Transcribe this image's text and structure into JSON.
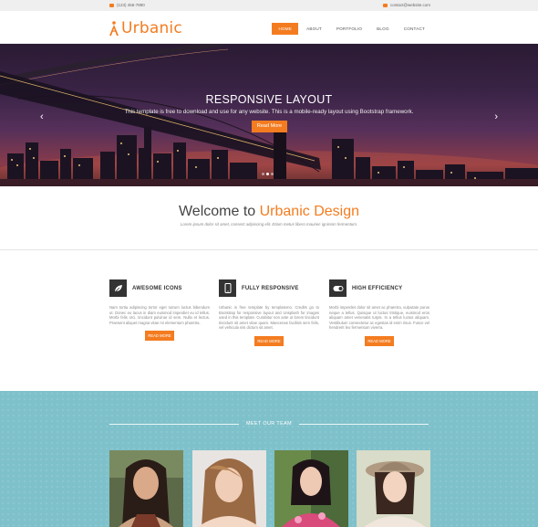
{
  "topbar": {
    "phone": "(123) 456-7890",
    "email": "contact@website.com"
  },
  "header": {
    "logo": "Urbanic",
    "nav": [
      {
        "label": "HOME",
        "active": true
      },
      {
        "label": "ABOUT",
        "active": false
      },
      {
        "label": "PORTFOLIO",
        "active": false
      },
      {
        "label": "BLOG",
        "active": false
      },
      {
        "label": "CONTACT",
        "active": false
      }
    ]
  },
  "hero": {
    "title": "RESPONSIVE LAYOUT",
    "subtitle": "This template is free to download and use for any website. This is a mobile-ready layout using Bootstrap framework.",
    "button": "Read More",
    "prev": "‹",
    "next": "›",
    "slides": 3,
    "active_slide": 2
  },
  "welcome": {
    "title_plain": "Welcome to ",
    "title_accent": "Urbanic Design",
    "subtitle": "Lorem ipsum dolor sit amet, consect adipiscing elit. Etiam metus libero mauriec ignissim fermentum."
  },
  "features": [
    {
      "icon": "leaf-icon",
      "title": "AWESOME ICONS",
      "text": "Nam tortia adipiscing tortor eget rutrum luctus bibendum ut. Donec eu lacus in diam euismod imperdiet eu id tellus. Morbi felis orci, tincidunt pulvinar id sem. Nulla et lectus. Praesent aliquet magna vitae mi elementum pharetra.",
      "button": "READ MORE"
    },
    {
      "icon": "mobile-icon",
      "title": "FULLY RESPONSIVE",
      "text": "Urbanic is free template by templatemo. Credits go to Bootstrap for responsive layout and Unsplash for images used in this template. Curabitur non ante ut lorem tincidunt tincidunt sit amet vitae quam. Maecenas facilisis sem felis, vel vehicula nisi dictum sit amet.",
      "button": "READ MORE"
    },
    {
      "icon": "toggle-icon",
      "title": "HIGH EFFICIENCY",
      "text": "Morbi imperdiet dolor sit amet ac pharetra, vulputate purus neque a tellus. Quisque ut luctus tristique, euismod eros aliquam amet venenatis turpis. In a tellus luctus aliquam. Vestibulum consectetur ac egestas id enim risus. Fusce vel hendrerit leo fermentum viverra.",
      "button": "READ MORE"
    }
  ],
  "team": {
    "label": "MEET OUR TEAM",
    "members": 4
  },
  "colors": {
    "accent": "#f47c20",
    "team_bg": "#7fc1cb",
    "dark": "#333333"
  }
}
